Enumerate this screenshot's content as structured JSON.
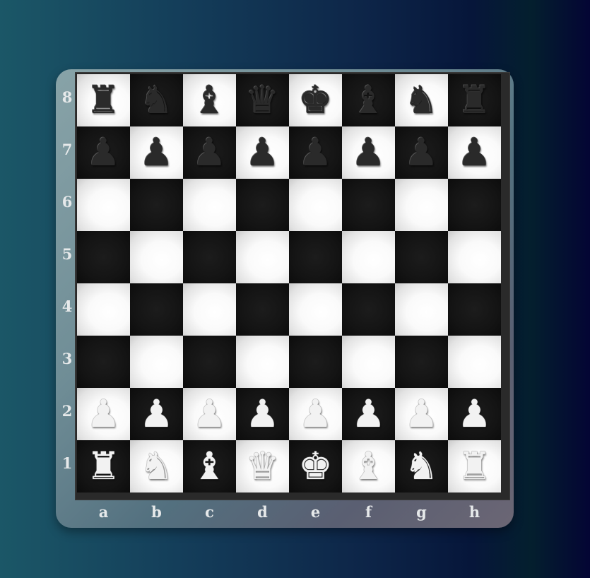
{
  "board": {
    "files": [
      "a",
      "b",
      "c",
      "d",
      "e",
      "f",
      "g",
      "h"
    ],
    "ranks": [
      "8",
      "7",
      "6",
      "5",
      "4",
      "3",
      "2",
      "1"
    ],
    "colors": {
      "light_square": "#ffffff",
      "dark_square": "#141414",
      "frame": "#6f8d96"
    },
    "position": [
      [
        "black-rook",
        "black-knight",
        "black-bishop",
        "black-queen",
        "black-king",
        "black-bishop",
        "black-knight",
        "black-rook"
      ],
      [
        "black-pawn",
        "black-pawn",
        "black-pawn",
        "black-pawn",
        "black-pawn",
        "black-pawn",
        "black-pawn",
        "black-pawn"
      ],
      [
        "",
        "",
        "",
        "",
        "",
        "",
        "",
        ""
      ],
      [
        "",
        "",
        "",
        "",
        "",
        "",
        "",
        ""
      ],
      [
        "",
        "",
        "",
        "",
        "",
        "",
        "",
        ""
      ],
      [
        "",
        "",
        "",
        "",
        "",
        "",
        "",
        ""
      ],
      [
        "white-pawn",
        "white-pawn",
        "white-pawn",
        "white-pawn",
        "white-pawn",
        "white-pawn",
        "white-pawn",
        "white-pawn"
      ],
      [
        "white-rook",
        "white-knight",
        "white-bishop",
        "white-queen",
        "white-king",
        "white-bishop",
        "white-knight",
        "white-rook"
      ]
    ]
  }
}
